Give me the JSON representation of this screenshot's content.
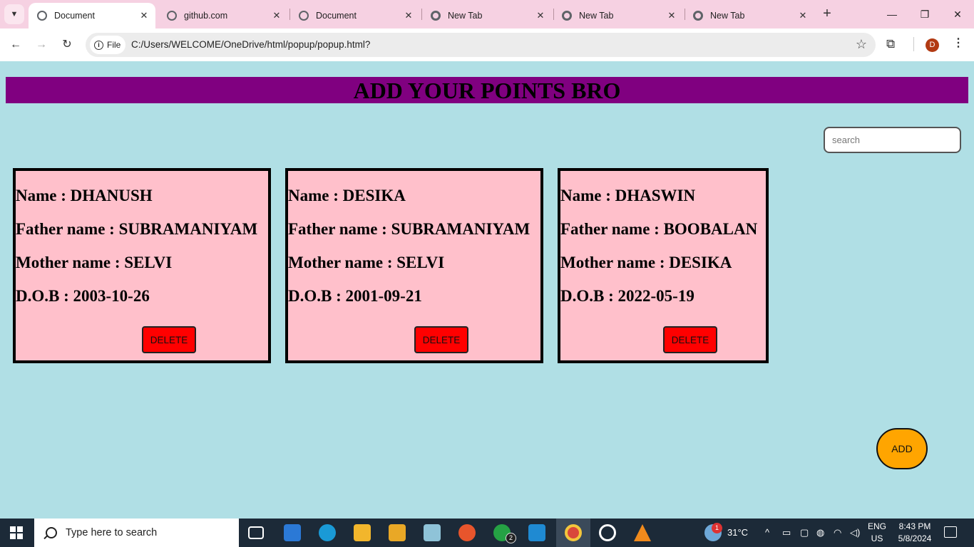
{
  "browser": {
    "tabs": [
      {
        "title": "Document",
        "active": true
      },
      {
        "title": "github.com",
        "active": false
      },
      {
        "title": "Document",
        "active": false
      },
      {
        "title": "New Tab",
        "active": false
      },
      {
        "title": "New Tab",
        "active": false
      },
      {
        "title": "New Tab",
        "active": false
      }
    ],
    "new_tab_icon": "+",
    "close_icon": "✕",
    "site_chip_label": "File",
    "url": "C:/Users/WELCOME/OneDrive/html/popup/popup.html?",
    "profile_initial": "D"
  },
  "page": {
    "header_title": "ADD YOUR POINTS BRO",
    "search_placeholder": "search",
    "cards": [
      {
        "name": "Name : DHANUSH",
        "father": "Father name : SUBRAMANIYAM",
        "mother": "Mother name : SELVI",
        "dob": "D.O.B : 2003-10-26",
        "delete_label": "DELETE"
      },
      {
        "name": "Name : DESIKA",
        "father": "Father name : SUBRAMANIYAM",
        "mother": "Mother name : SELVI",
        "dob": "D.O.B : 2001-09-21",
        "delete_label": "DELETE"
      },
      {
        "name": "Name : DHASWIN",
        "father": "Father name : BOOBALAN",
        "mother": "Mother name : DESIKA",
        "dob": "D.O.B : 2022-05-19",
        "delete_label": "DELETE"
      }
    ],
    "add_label": "ADD",
    "colors": {
      "background": "#b0dfe5",
      "header": "#800080",
      "card": "#ffc0cb",
      "delete": "#ff0000",
      "add": "#ffa500"
    }
  },
  "taskbar": {
    "search_placeholder": "Type here to search",
    "whatsapp_badge": "2",
    "weather_badge": "1",
    "temperature": "31°C",
    "lang_line1": "ENG",
    "lang_line2": "US",
    "time": "8:43 PM",
    "date": "5/8/2024",
    "apps": [
      "task-view",
      "mail",
      "edge",
      "file-explorer",
      "microsoft-store",
      "notepad",
      "firefox",
      "whatsapp",
      "vscode",
      "chrome",
      "settings",
      "vlc"
    ]
  }
}
